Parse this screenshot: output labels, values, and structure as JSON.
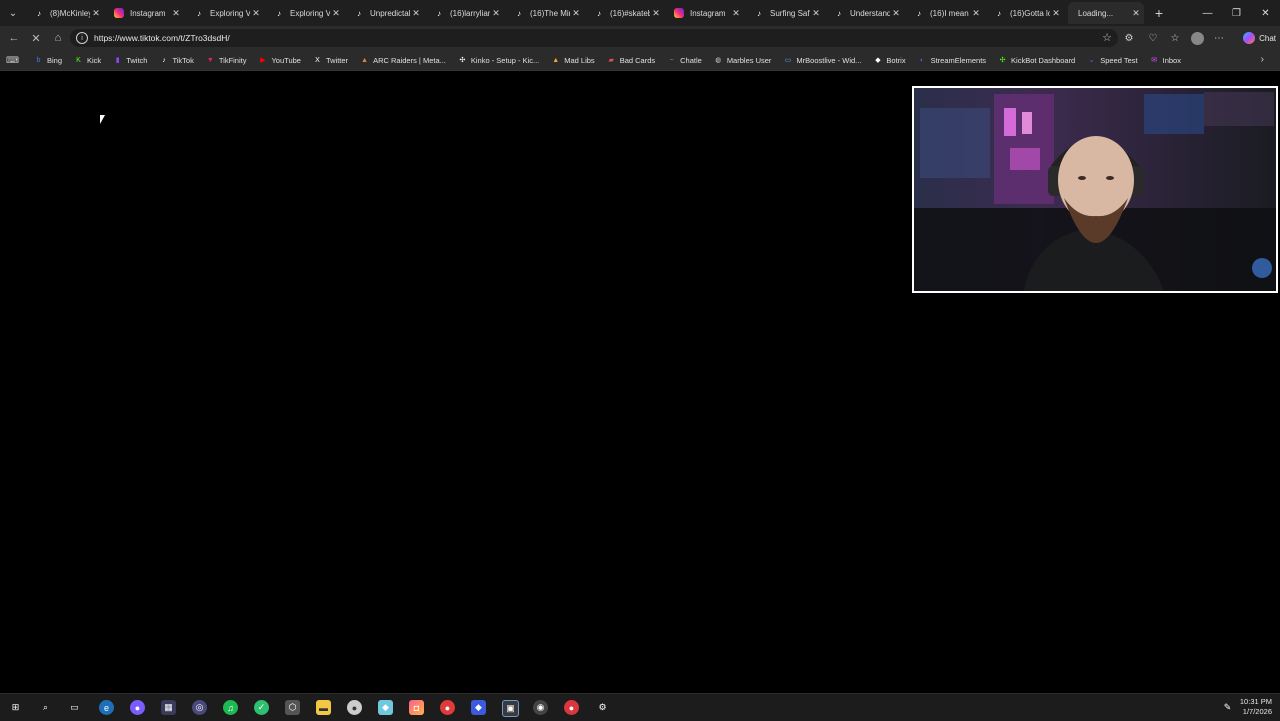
{
  "tabs": [
    {
      "title": "(8)McKinley o",
      "icon": "tiktok-icon"
    },
    {
      "title": "Instagram",
      "icon": "instagram-icon"
    },
    {
      "title": "Exploring Vo",
      "icon": "tiktok-icon"
    },
    {
      "title": "Exploring Vo",
      "icon": "tiktok-icon"
    },
    {
      "title": "Unpredictab",
      "icon": "tiktok-icon"
    },
    {
      "title": "(16)larryliam",
      "icon": "tiktok-icon"
    },
    {
      "title": "(16)The Minn",
      "icon": "tiktok-icon"
    },
    {
      "title": "(16)#skatebo",
      "icon": "tiktok-icon"
    },
    {
      "title": "Instagram",
      "icon": "instagram-icon"
    },
    {
      "title": "Surfing Safet",
      "icon": "tiktok-icon"
    },
    {
      "title": "Understandir",
      "icon": "tiktok-icon"
    },
    {
      "title": "(16)I mean #",
      "icon": "tiktok-icon"
    },
    {
      "title": "(16)Gotta lov",
      "icon": "tiktok-icon"
    },
    {
      "title": "Loading...",
      "icon": "loading-icon",
      "active": true
    }
  ],
  "address": {
    "url": "https://www.tiktok.com/t/ZTro3dsdH/"
  },
  "toolbar": {
    "chat_label": "Chat"
  },
  "bookmarks": [
    {
      "label": "Bing",
      "icon": "bing-icon",
      "color": "#3b7bdc"
    },
    {
      "label": "Kick",
      "icon": "kick-icon",
      "color": "#53fc18"
    },
    {
      "label": "Twitch",
      "icon": "twitch-icon",
      "color": "#9146ff"
    },
    {
      "label": "TikTok",
      "icon": "tiktok-icon",
      "color": "#ffffff"
    },
    {
      "label": "TikFinity",
      "icon": "tikfinity-icon",
      "color": "#e0245e"
    },
    {
      "label": "YouTube",
      "icon": "youtube-icon",
      "color": "#ff0000"
    },
    {
      "label": "Twitter",
      "icon": "x-icon",
      "color": "#ffffff"
    },
    {
      "label": "ARC Raiders | Meta...",
      "icon": "arc-raiders-icon",
      "color": "#e8803a"
    },
    {
      "label": "Kinko - Setup - Kic...",
      "icon": "kinko-icon",
      "color": "#ffffff"
    },
    {
      "label": "Mad Libs",
      "icon": "mad-libs-icon",
      "color": "#f5a623"
    },
    {
      "label": "Bad Cards",
      "icon": "bad-cards-icon",
      "color": "#d9534f"
    },
    {
      "label": "Chatle",
      "icon": "chatle-icon",
      "color": "#b566ff"
    },
    {
      "label": "Marbles User",
      "icon": "globe-icon",
      "color": "#cfcfcf"
    },
    {
      "label": "MrBoostlive - Wid...",
      "icon": "mrboost-icon",
      "color": "#5aa0ff"
    },
    {
      "label": "Botrix",
      "icon": "botrix-icon",
      "color": "#ffffff"
    },
    {
      "label": "StreamElements",
      "icon": "streamelements-icon",
      "color": "#5b4dff"
    },
    {
      "label": "KickBot Dashboard",
      "icon": "kickbot-icon",
      "color": "#53fc18"
    },
    {
      "label": "Speed Test",
      "icon": "speedtest-icon",
      "color": "#3b7bdc"
    },
    {
      "label": "Inbox",
      "icon": "inbox-icon",
      "color": "#e24cff"
    }
  ],
  "taskbar": {
    "time": "10:31 PM",
    "date": "1/7/2026"
  }
}
